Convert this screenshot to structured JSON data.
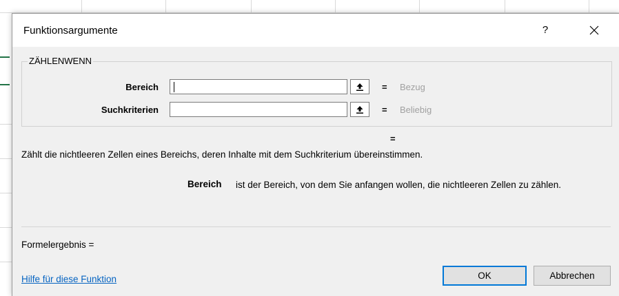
{
  "dialog": {
    "title": "Funktionsargumente",
    "help_label": "?",
    "close_label": "✕"
  },
  "function_name": "ZÄHLENWENN",
  "arguments": [
    {
      "label": "Bereich",
      "value": "",
      "equals": "=",
      "type": "Bezug"
    },
    {
      "label": "Suchkriterien",
      "value": "",
      "equals": "=",
      "type": "Beliebig"
    }
  ],
  "result_equals": "=",
  "description": "Zählt die nichtleeren Zellen eines Bereichs, deren Inhalte mit dem Suchkriterium übereinstimmen.",
  "argument_help": {
    "name": "Bereich",
    "text": "ist der Bereich, von dem Sie anfangen wollen, die nichtleeren Zellen zu zählen."
  },
  "formula_result_label": "Formelergebnis =",
  "help_link": "Hilfe für diese Funktion",
  "buttons": {
    "ok": "OK",
    "cancel": "Abbrechen"
  },
  "icons": {
    "ref_button": "collapse-dialog-arrow-icon",
    "close": "close-icon"
  }
}
